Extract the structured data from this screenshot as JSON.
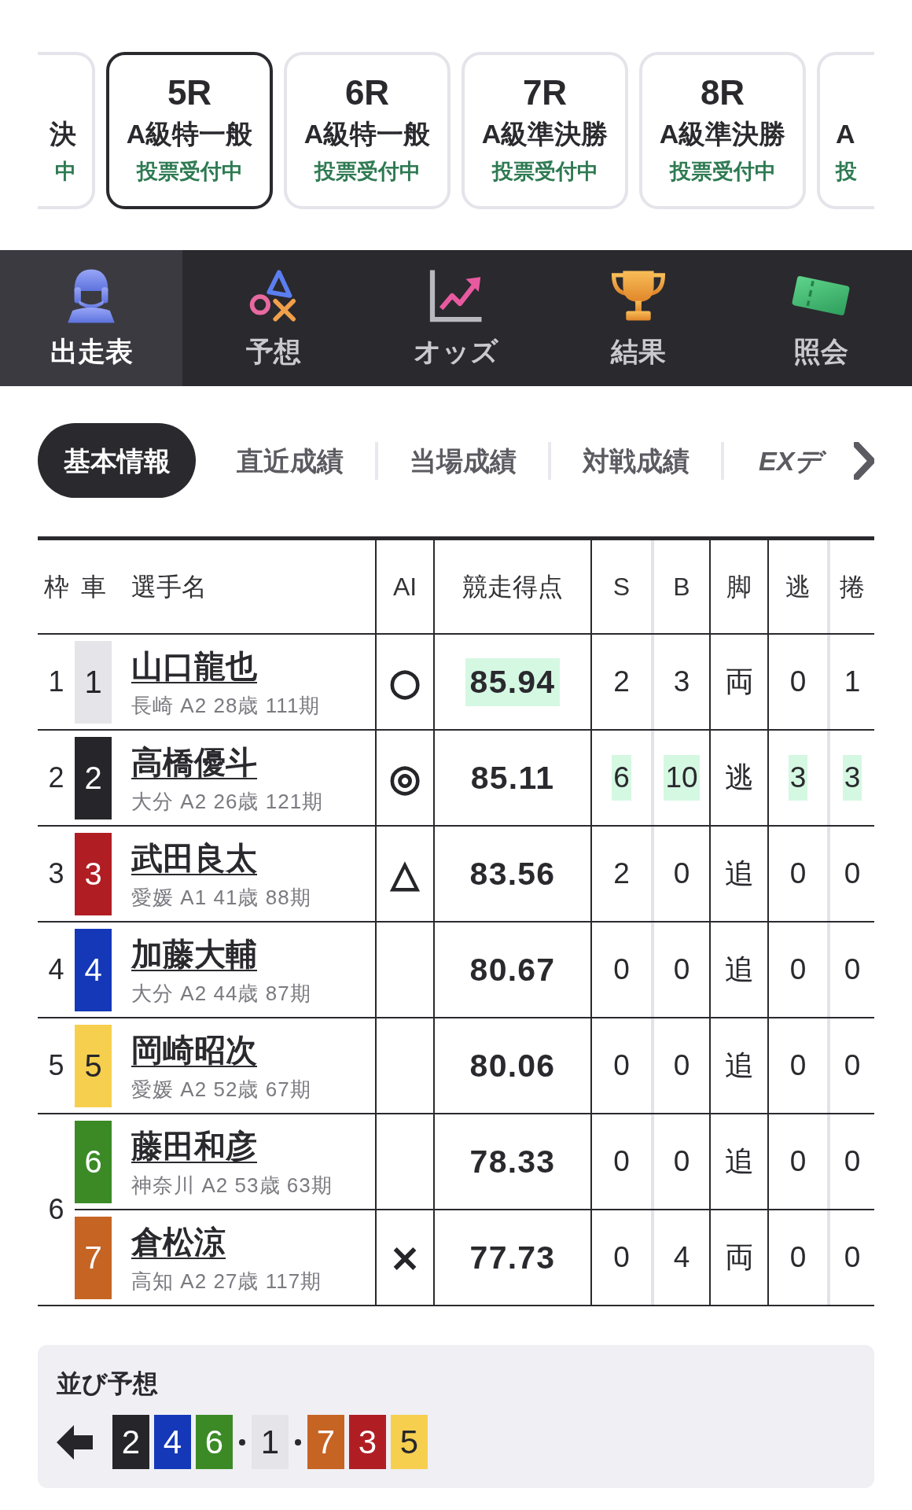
{
  "races": [
    {
      "kind": "cut_left",
      "class": "決",
      "status": "中",
      "selected": false
    },
    {
      "kind": "full",
      "number": "5R",
      "class": "A級特一般",
      "status": "投票受付中",
      "selected": true
    },
    {
      "kind": "full",
      "number": "6R",
      "class": "A級特一般",
      "status": "投票受付中",
      "selected": false
    },
    {
      "kind": "full",
      "number": "7R",
      "class": "A級準決勝",
      "status": "投票受付中",
      "selected": false
    },
    {
      "kind": "full",
      "number": "8R",
      "class": "A級準決勝",
      "status": "投票受付中",
      "selected": false
    },
    {
      "kind": "cut_right",
      "class": "A",
      "status": "投",
      "selected": false
    }
  ],
  "nav": {
    "items": [
      {
        "label": "出走表",
        "selected": true
      },
      {
        "label": "予想",
        "selected": false
      },
      {
        "label": "オッズ",
        "selected": false
      },
      {
        "label": "結果",
        "selected": false
      },
      {
        "label": "照会",
        "selected": false
      }
    ]
  },
  "sub_tabs": [
    {
      "kind": "plain",
      "label": "基本情報",
      "selected": true
    },
    {
      "kind": "plain",
      "label": "直近成績",
      "selected": false
    },
    {
      "kind": "plain",
      "label": "当場成績",
      "selected": false
    },
    {
      "kind": "plain",
      "label": "対戦成績",
      "selected": false
    },
    {
      "kind": "ex",
      "label": "EXデ",
      "selected": false
    }
  ],
  "table": {
    "columns": [
      "枠",
      "車",
      "選手名",
      "AI",
      "競走得点",
      "S",
      "B",
      "脚",
      "逃",
      "捲"
    ],
    "frames": [
      {
        "frame": "1",
        "riders": [
          {
            "car": "1",
            "color": "#e4e4e9",
            "name": "山口龍也",
            "profile": "長崎 A2 28歳 111期",
            "ai_mark": "○",
            "score": "85.94",
            "score_highlighted": true,
            "stats": [
              {
                "text": "2",
                "highlighted": false
              },
              {
                "text": "3",
                "highlighted": false
              },
              {
                "text": "両",
                "highlighted": false
              },
              {
                "text": "0",
                "highlighted": false
              },
              {
                "text": "1",
                "highlighted": false
              }
            ]
          }
        ]
      },
      {
        "frame": "2",
        "riders": [
          {
            "car": "2",
            "color": "#26262a",
            "name": "高橋優斗",
            "profile": "大分 A2 26歳 121期",
            "ai_mark": "◎",
            "score": "85.11",
            "score_highlighted": false,
            "stats": [
              {
                "text": "6",
                "highlighted": true
              },
              {
                "text": "10",
                "highlighted": true
              },
              {
                "text": "逃",
                "highlighted": false
              },
              {
                "text": "3",
                "highlighted": true
              },
              {
                "text": "3",
                "highlighted": true
              }
            ]
          }
        ]
      },
      {
        "frame": "3",
        "riders": [
          {
            "car": "3",
            "color": "#b01e23",
            "name": "武田良太",
            "profile": "愛媛 A1 41歳 88期",
            "ai_mark": "△",
            "score": "83.56",
            "score_highlighted": false,
            "stats": [
              {
                "text": "2",
                "highlighted": false
              },
              {
                "text": "0",
                "highlighted": false
              },
              {
                "text": "追",
                "highlighted": false
              },
              {
                "text": "0",
                "highlighted": false
              },
              {
                "text": "0",
                "highlighted": false
              }
            ]
          }
        ]
      },
      {
        "frame": "4",
        "riders": [
          {
            "car": "4",
            "color": "#1538b9",
            "name": "加藤大輔",
            "profile": "大分 A2 44歳 87期",
            "score": "80.67",
            "score_highlighted": false,
            "stats": [
              {
                "text": "0",
                "highlighted": false
              },
              {
                "text": "0",
                "highlighted": false
              },
              {
                "text": "追",
                "highlighted": false
              },
              {
                "text": "0",
                "highlighted": false
              },
              {
                "text": "0",
                "highlighted": false
              }
            ]
          }
        ]
      },
      {
        "frame": "5",
        "riders": [
          {
            "car": "5",
            "color": "#f7cf4f",
            "name": "岡崎昭次",
            "profile": "愛媛 A2 52歳 67期",
            "score": "80.06",
            "score_highlighted": false,
            "stats": [
              {
                "text": "0",
                "highlighted": false
              },
              {
                "text": "0",
                "highlighted": false
              },
              {
                "text": "追",
                "highlighted": false
              },
              {
                "text": "0",
                "highlighted": false
              },
              {
                "text": "0",
                "highlighted": false
              }
            ]
          }
        ]
      },
      {
        "frame": "6",
        "riders": [
          {
            "car": "6",
            "color": "#3b8a26",
            "name": "藤田和彦",
            "profile": "神奈川 A2 53歳 63期",
            "score": "78.33",
            "score_highlighted": false,
            "stats": [
              {
                "text": "0",
                "highlighted": false
              },
              {
                "text": "0",
                "highlighted": false
              },
              {
                "text": "追",
                "highlighted": false
              },
              {
                "text": "0",
                "highlighted": false
              },
              {
                "text": "0",
                "highlighted": false
              }
            ]
          },
          {
            "car": "7",
            "color": "#c66424",
            "name": "倉松涼",
            "profile": "高知 A2 27歳 117期",
            "ai_mark": "×",
            "score": "77.73",
            "score_highlighted": false,
            "stats": [
              {
                "text": "0",
                "highlighted": false
              },
              {
                "text": "4",
                "highlighted": false
              },
              {
                "text": "両",
                "highlighted": false
              },
              {
                "text": "0",
                "highlighted": false
              },
              {
                "text": "0",
                "highlighted": false
              }
            ]
          }
        ]
      }
    ]
  },
  "line_prediction": {
    "title": "並び予想",
    "groups": [
      {
        "cars": [
          {
            "car": "2",
            "color": "#26262a"
          },
          {
            "car": "4",
            "color": "#1538b9"
          },
          {
            "car": "6",
            "color": "#3b8a26"
          }
        ]
      },
      {
        "cars": [
          {
            "car": "1",
            "color": "#e4e4e9"
          }
        ]
      },
      {
        "cars": [
          {
            "car": "7",
            "color": "#c66424"
          },
          {
            "car": "3",
            "color": "#b01e23"
          },
          {
            "car": "5",
            "color": "#f7cf4f"
          }
        ]
      }
    ]
  }
}
